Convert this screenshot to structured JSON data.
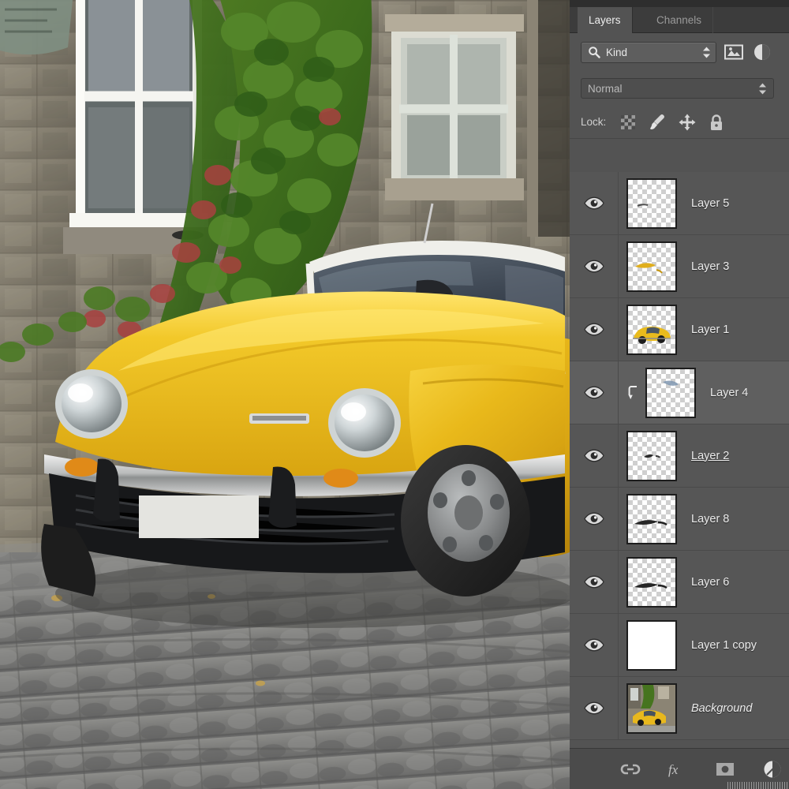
{
  "app": {
    "panel_title": "Layers"
  },
  "tabs": [
    {
      "label": "Layers",
      "active": true
    },
    {
      "label": "Channels",
      "active": false
    }
  ],
  "filter": {
    "kind_label": "Kind",
    "search_icon": "search-icon",
    "pixel_filter_icon": "image-filter-icon",
    "adjustment_filter_icon": "adjustment-filter-icon"
  },
  "blend": {
    "mode": "Normal"
  },
  "lock": {
    "label": "Lock:",
    "icons": [
      "transparency-lock-icon",
      "brush-lock-icon",
      "position-lock-icon",
      "lock-all-icon"
    ]
  },
  "layers": [
    {
      "name": "Layer 5",
      "visible": true,
      "thumb": "transparent",
      "clipped": false,
      "selected": false,
      "italic": false,
      "editing": false,
      "art": "tiny-streak"
    },
    {
      "name": "Layer 3",
      "visible": true,
      "thumb": "transparent",
      "clipped": false,
      "selected": false,
      "italic": false,
      "editing": false,
      "art": "yellow-streak"
    },
    {
      "name": "Layer 1",
      "visible": true,
      "thumb": "transparent",
      "clipped": false,
      "selected": false,
      "italic": false,
      "editing": false,
      "art": "yellow-car"
    },
    {
      "name": "Layer 4",
      "visible": true,
      "thumb": "transparent",
      "clipped": true,
      "selected": true,
      "italic": false,
      "editing": false,
      "art": "blue-smudge"
    },
    {
      "name": "Layer 2",
      "visible": true,
      "thumb": "transparent",
      "clipped": false,
      "selected": false,
      "italic": false,
      "editing": true,
      "art": "dark-smudge"
    },
    {
      "name": "Layer 8",
      "visible": true,
      "thumb": "transparent",
      "clipped": false,
      "selected": false,
      "italic": false,
      "editing": false,
      "art": "dark-streak"
    },
    {
      "name": "Layer 6",
      "visible": true,
      "thumb": "transparent",
      "clipped": false,
      "selected": false,
      "italic": false,
      "editing": false,
      "art": "dark-streak"
    },
    {
      "name": "Layer 1 copy",
      "visible": true,
      "thumb": "white",
      "clipped": false,
      "selected": false,
      "italic": false,
      "editing": false,
      "art": "none"
    },
    {
      "name": "Background",
      "visible": true,
      "thumb": "photo",
      "clipped": false,
      "selected": false,
      "italic": true,
      "editing": false,
      "art": "photo"
    }
  ],
  "bottom_bar": {
    "icons": [
      "link-layers-icon",
      "layer-style-fx-icon",
      "layer-mask-icon",
      "new-adjustment-layer-icon"
    ]
  },
  "canvas": {
    "description": "yellow-classic-convertible-car-photo",
    "subject": "Yellow Triumph Spitfire parked on cobblestones in front of an ivy-covered stone cottage"
  },
  "colors": {
    "panel_bg": "#535353",
    "row_bg": "#565656",
    "row_selected_bg": "#5f5f5f",
    "tabbar_bg": "#3c3c3c",
    "text": "#ececec",
    "car_yellow": "#e8b81d"
  }
}
